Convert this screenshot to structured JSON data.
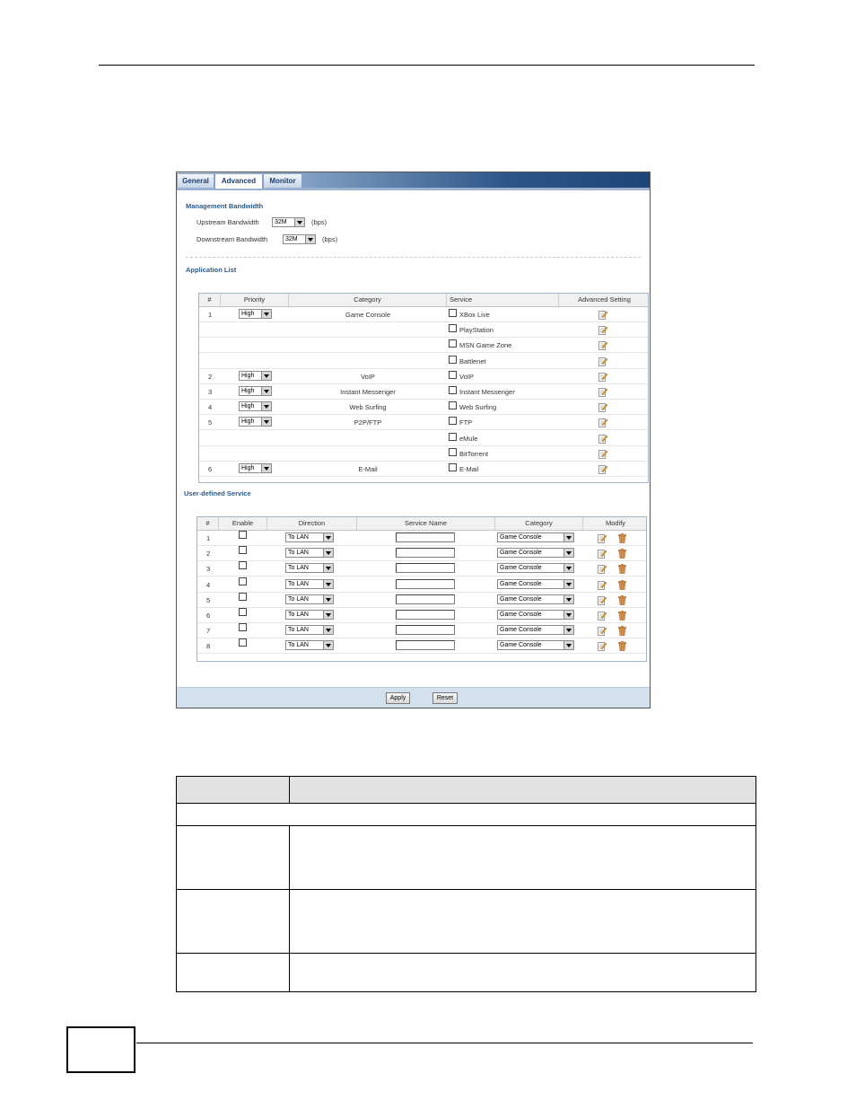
{
  "tabs": [
    {
      "label": "General"
    },
    {
      "label": "Advanced"
    },
    {
      "label": "Monitor"
    }
  ],
  "management": {
    "title": "Management Bandwidth",
    "upstream_label": "Upstream Bandwidth",
    "upstream_value": "32M",
    "downstream_label": "Downstream Bandwidth",
    "downstream_value": "32M",
    "unit": "(bps)"
  },
  "app_list": {
    "title": "Application List",
    "headers": [
      "#",
      "Priority",
      "Category",
      "Service",
      "Advanced Setting"
    ],
    "rows": [
      {
        "num": "1",
        "priority": "High",
        "category": "Game Console",
        "service": "XBox Live"
      },
      {
        "num": "",
        "priority": "",
        "category": "",
        "service": "PlayStation"
      },
      {
        "num": "",
        "priority": "",
        "category": "",
        "service": "MSN Game Zone"
      },
      {
        "num": "",
        "priority": "",
        "category": "",
        "service": "Battlenet"
      },
      {
        "num": "2",
        "priority": "High",
        "category": "VoIP",
        "service": "VoIP"
      },
      {
        "num": "3",
        "priority": "High",
        "category": "Instant Messenger",
        "service": "Instant Messenger"
      },
      {
        "num": "4",
        "priority": "High",
        "category": "Web Surfing",
        "service": "Web Surfing"
      },
      {
        "num": "5",
        "priority": "High",
        "category": "P2P/FTP",
        "service": "FTP"
      },
      {
        "num": "",
        "priority": "",
        "category": "",
        "service": "eMule"
      },
      {
        "num": "",
        "priority": "",
        "category": "",
        "service": "BitTorrent"
      },
      {
        "num": "6",
        "priority": "High",
        "category": "E-Mail",
        "service": "E-Mail"
      }
    ]
  },
  "user_defined": {
    "title": "User-defined Service",
    "headers": [
      "#",
      "Enable",
      "Direction",
      "Service Name",
      "Category",
      "Modify"
    ],
    "rows": [
      {
        "num": "1",
        "direction": "To LAN",
        "service_name": "",
        "category": "Game Console"
      },
      {
        "num": "2",
        "direction": "To LAN",
        "service_name": "",
        "category": "Game Console"
      },
      {
        "num": "3",
        "direction": "To LAN",
        "service_name": "",
        "category": "Game Console"
      },
      {
        "num": "4",
        "direction": "To LAN",
        "service_name": "",
        "category": "Game Console"
      },
      {
        "num": "5",
        "direction": "To LAN",
        "service_name": "",
        "category": "Game Console"
      },
      {
        "num": "6",
        "direction": "To LAN",
        "service_name": "",
        "category": "Game Console"
      },
      {
        "num": "7",
        "direction": "To LAN",
        "service_name": "",
        "category": "Game Console"
      },
      {
        "num": "8",
        "direction": "To LAN",
        "service_name": "",
        "category": "Game Console"
      }
    ]
  },
  "buttons": {
    "apply": "Apply",
    "reset": "Reset"
  },
  "colors": {
    "accent": "#2a5a8a",
    "tab_bar": "#2d5688",
    "footer": "#d3e1ef"
  }
}
